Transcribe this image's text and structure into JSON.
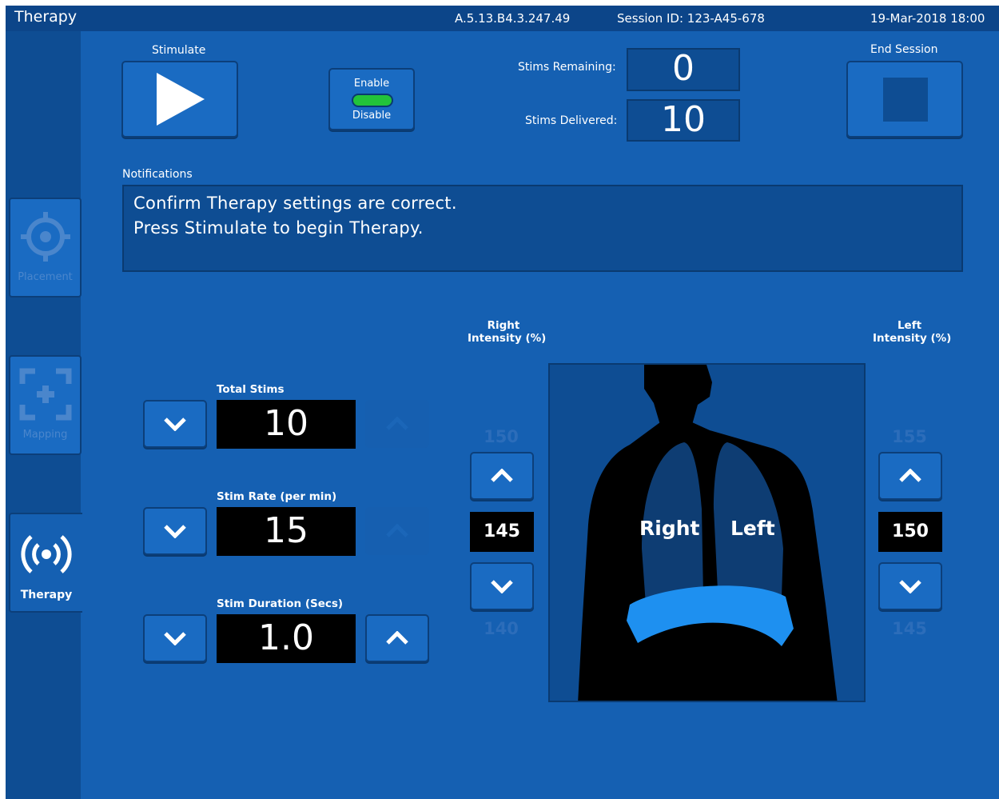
{
  "header": {
    "title": "Therapy",
    "version": "A.5.13.B4.3.247.49",
    "session": "Session ID: 123-A45-678",
    "datetime": "19-Mar-2018  18:00"
  },
  "sidebar": {
    "items": [
      {
        "label": "Placement",
        "icon": "crosshair-icon",
        "state": "dim"
      },
      {
        "label": "Mapping",
        "icon": "focus-frame-icon",
        "state": "dim"
      },
      {
        "label": "Therapy",
        "icon": "broadcast-icon",
        "state": "active"
      }
    ]
  },
  "controls": {
    "stimulate_label": "Stimulate",
    "enable_label": "Enable",
    "disable_label": "Disable",
    "toggle_color": "#22c33a",
    "end_session_label": "End Session",
    "stims_remaining_label": "Stims Remaining:",
    "stims_remaining": "0",
    "stims_delivered_label": "Stims Delivered:",
    "stims_delivered": "10"
  },
  "notifications": {
    "label": "Notifications",
    "line1": "Confirm Therapy settings are correct.",
    "line2": "Press Stimulate to begin Therapy."
  },
  "settings": {
    "total_stims": {
      "label": "Total Stims",
      "value": "10"
    },
    "stim_rate": {
      "label": "Stim Rate (per min)",
      "value": "15"
    },
    "stim_duration": {
      "label": "Stim Duration (Secs)",
      "value": "1.0"
    }
  },
  "intensity": {
    "right": {
      "label_line1": "Right",
      "label_line2": "Intensity (%)",
      "above": "150",
      "value": "145",
      "below": "140"
    },
    "left": {
      "label_line1": "Left",
      "label_line2": "Intensity (%)",
      "above": "155",
      "value": "150",
      "below": "145"
    }
  },
  "diagram": {
    "right_label": "Right",
    "left_label": "Left",
    "diaphragm_color": "#1e90f0",
    "lung_color": "#0e3d73"
  }
}
